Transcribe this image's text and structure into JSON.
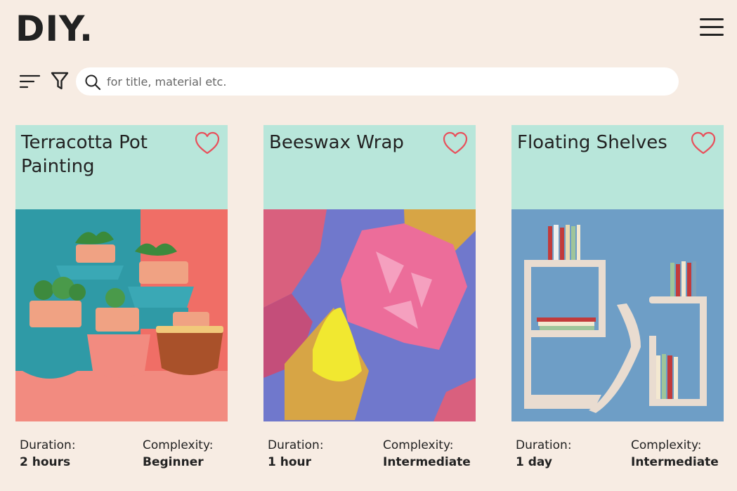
{
  "header": {
    "logo": "DIY."
  },
  "search": {
    "placeholder": "for title, material etc."
  },
  "icons": {
    "menu": "hamburger-menu-icon",
    "sort": "sort-icon",
    "filter": "filter-icon",
    "search": "search-icon",
    "favorite": "heart-icon"
  },
  "colors": {
    "background": "#f7ece3",
    "card_header": "#b8e6da",
    "heart": "#e8505b"
  },
  "labels": {
    "duration": "Duration:",
    "complexity": "Complexity:"
  },
  "cards": [
    {
      "title": "Terracotta Pot Painting",
      "duration": "2 hours",
      "complexity": "Beginner"
    },
    {
      "title": "Beeswax Wrap",
      "duration": "1 hour",
      "complexity": "Intermediate"
    },
    {
      "title": "Floating Shelves",
      "duration": "1 day",
      "complexity": "Intermediate"
    }
  ]
}
